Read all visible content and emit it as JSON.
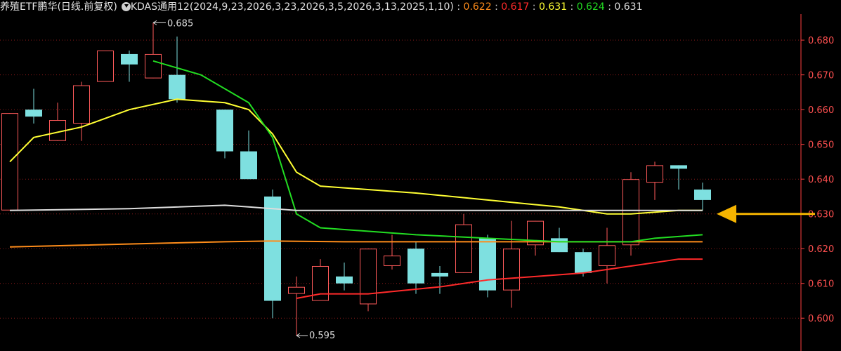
{
  "header": {
    "symbol": "养殖ETF鹏华",
    "period": "(日线.前复权)",
    "indicator": "KDAS通用12(2024,9,23,2026,3,23,2026,3,5,2026,3,13,2025,1,10)",
    "values": [
      {
        "text": "0.622",
        "color": "#ff8c1a"
      },
      {
        "text": "0.617",
        "color": "#ff2a2a"
      },
      {
        "text": "0.631",
        "color": "#ffff33"
      },
      {
        "text": "0.624",
        "color": "#22dd22"
      },
      {
        "text": "0.631",
        "color": "#dddddd"
      }
    ]
  },
  "chart_data": {
    "type": "candlestick",
    "ylim": [
      0.595,
      0.6875
    ],
    "yticks": [
      "0.680",
      "0.670",
      "0.660",
      "0.650",
      "0.640",
      "0.630",
      "0.620",
      "0.610",
      "0.600"
    ],
    "high_label": "0.685",
    "low_label": "0.595",
    "colors": {
      "up": "#ff5a5a",
      "down": "#7ee0e0",
      "grid": "#8a1a1a",
      "axis": "#ff4040"
    },
    "candles": [
      {
        "o": 0.631,
        "h": 0.659,
        "l": 0.631,
        "c": 0.659
      },
      {
        "o": 0.66,
        "h": 0.666,
        "l": 0.656,
        "c": 0.658
      },
      {
        "o": 0.651,
        "h": 0.662,
        "l": 0.651,
        "c": 0.657
      },
      {
        "o": 0.656,
        "h": 0.668,
        "l": 0.651,
        "c": 0.667
      },
      {
        "o": 0.668,
        "h": 0.677,
        "l": 0.668,
        "c": 0.677
      },
      {
        "o": 0.676,
        "h": 0.677,
        "l": 0.668,
        "c": 0.673
      },
      {
        "o": 0.669,
        "h": 0.685,
        "l": 0.669,
        "c": 0.676
      },
      {
        "o": 0.67,
        "h": 0.681,
        "l": 0.662,
        "c": 0.663
      },
      null,
      {
        "o": 0.66,
        "h": 0.66,
        "l": 0.646,
        "c": 0.648
      },
      {
        "o": 0.648,
        "h": 0.654,
        "l": 0.64,
        "c": 0.64
      },
      {
        "o": 0.635,
        "h": 0.637,
        "l": 0.6,
        "c": 0.605
      },
      {
        "o": 0.607,
        "h": 0.612,
        "l": 0.595,
        "c": 0.609
      },
      {
        "o": 0.605,
        "h": 0.617,
        "l": 0.605,
        "c": 0.615
      },
      {
        "o": 0.612,
        "h": 0.616,
        "l": 0.608,
        "c": 0.61
      },
      {
        "o": 0.604,
        "h": 0.62,
        "l": 0.602,
        "c": 0.62
      },
      {
        "o": 0.615,
        "h": 0.624,
        "l": 0.614,
        "c": 0.618
      },
      {
        "o": 0.62,
        "h": 0.622,
        "l": 0.607,
        "c": 0.61
      },
      {
        "o": 0.613,
        "h": 0.615,
        "l": 0.607,
        "c": 0.612
      },
      {
        "o": 0.613,
        "h": 0.63,
        "l": 0.613,
        "c": 0.627
      },
      {
        "o": 0.623,
        "h": 0.624,
        "l": 0.606,
        "c": 0.608
      },
      {
        "o": 0.608,
        "h": 0.628,
        "l": 0.603,
        "c": 0.62
      },
      {
        "o": 0.621,
        "h": 0.628,
        "l": 0.618,
        "c": 0.628
      },
      {
        "o": 0.623,
        "h": 0.626,
        "l": 0.619,
        "c": 0.619
      },
      {
        "o": 0.619,
        "h": 0.62,
        "l": 0.612,
        "c": 0.613
      },
      {
        "o": 0.615,
        "h": 0.626,
        "l": 0.61,
        "c": 0.621
      },
      {
        "o": 0.621,
        "h": 0.642,
        "l": 0.618,
        "c": 0.64
      },
      {
        "o": 0.639,
        "h": 0.645,
        "l": 0.634,
        "c": 0.644
      },
      {
        "o": 0.644,
        "h": 0.644,
        "l": 0.637,
        "c": 0.643
      },
      {
        "o": 0.637,
        "h": 0.639,
        "l": 0.631,
        "c": 0.634
      }
    ],
    "series": [
      {
        "color": "#ff8c1a",
        "points": [
          [
            0,
            0.6205
          ],
          [
            3,
            0.621
          ],
          [
            6,
            0.6215
          ],
          [
            9,
            0.622
          ],
          [
            11,
            0.6222
          ],
          [
            14,
            0.622
          ],
          [
            20,
            0.622
          ],
          [
            29,
            0.622
          ]
        ]
      },
      {
        "color": "#ff2a2a",
        "points": [
          [
            12,
            0.6057
          ],
          [
            13,
            0.607
          ],
          [
            15,
            0.607
          ],
          [
            18,
            0.609
          ],
          [
            20,
            0.611
          ],
          [
            22,
            0.612
          ],
          [
            24,
            0.613
          ],
          [
            26,
            0.615
          ],
          [
            28,
            0.617
          ],
          [
            29,
            0.617
          ]
        ]
      },
      {
        "color": "#ffff33",
        "points": [
          [
            0,
            0.645
          ],
          [
            1,
            0.652
          ],
          [
            3,
            0.655
          ],
          [
            5,
            0.66
          ],
          [
            7,
            0.663
          ],
          [
            9,
            0.662
          ],
          [
            10,
            0.66
          ],
          [
            11,
            0.653
          ],
          [
            12,
            0.642
          ],
          [
            13,
            0.638
          ],
          [
            17,
            0.636
          ],
          [
            20,
            0.634
          ],
          [
            23,
            0.632
          ],
          [
            25,
            0.63
          ],
          [
            26,
            0.63
          ],
          [
            28,
            0.631
          ],
          [
            29,
            0.631
          ]
        ]
      },
      {
        "color": "#22dd22",
        "points": [
          [
            6,
            0.674
          ],
          [
            8,
            0.67
          ],
          [
            10,
            0.662
          ],
          [
            11,
            0.652
          ],
          [
            12,
            0.63
          ],
          [
            13,
            0.626
          ],
          [
            17,
            0.624
          ],
          [
            20,
            0.623
          ],
          [
            23,
            0.622
          ],
          [
            25,
            0.622
          ],
          [
            26,
            0.622
          ],
          [
            27,
            0.623
          ],
          [
            29,
            0.624
          ]
        ]
      },
      {
        "color": "#dddddd",
        "points": [
          [
            0,
            0.631
          ],
          [
            5,
            0.6315
          ],
          [
            9,
            0.6325
          ],
          [
            10,
            0.632
          ],
          [
            12,
            0.631
          ],
          [
            20,
            0.631
          ],
          [
            29,
            0.631
          ]
        ]
      }
    ],
    "arrow": {
      "value": 0.63,
      "color": "#f5b400"
    }
  }
}
